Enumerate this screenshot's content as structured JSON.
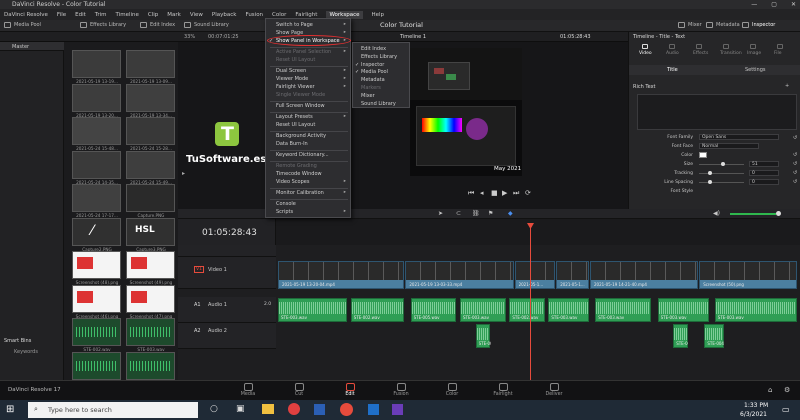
{
  "window": {
    "title": "DaVinci Resolve - Color Tutorial"
  },
  "menubar": [
    "DaVinci Resolve",
    "File",
    "Edit",
    "Trim",
    "Timeline",
    "Clip",
    "Mark",
    "View",
    "Playback",
    "Fusion",
    "Color",
    "Fairlight",
    "Workspace",
    "Help"
  ],
  "toolbar": {
    "media_pool": "Media Pool",
    "effects_library": "Effects Library",
    "edit_index": "Edit Index",
    "sound_library": "Sound Library",
    "project_title": "Color Tutorial",
    "mixer": "Mixer",
    "metadata": "Metadata",
    "inspector": "Inspector"
  },
  "subbar": {
    "zoom": "33%",
    "timecode_left": "00:07:01:25",
    "timeline_name": "Timeline 1",
    "timecode_right": "01:05:28:43"
  },
  "left_panel": {
    "master": "Master",
    "smart_bins": "Smart Bins",
    "keywords": "Keywords"
  },
  "media_pool": {
    "items": [
      "2021-05-19 13-19...",
      "2021-05-19 13-09...",
      "2021-05-19 13-20...",
      "2021-05-19 13-34...",
      "2021-05-24 15-48...",
      "2021-05-24 15-28...",
      "2021-05-24 14-35...",
      "2021-05-24 15-49...",
      "2021-05-24 17-17...",
      "Capture.PNG",
      "Capture2.PNG",
      "Capture3.PNG",
      "Screenshot (48).png",
      "Screenshot (49).png",
      "Screenshot (46).png",
      "Screenshot (47).png",
      "STE-002.wav",
      "STE-003.wav",
      "STE-004.wav",
      "STE-005.wav"
    ]
  },
  "workspace_menu": {
    "items": [
      {
        "label": "Switch to Page",
        "arrow": true
      },
      {
        "label": "Show Page",
        "arrow": true
      },
      {
        "label": "Show Panel in Workspace",
        "arrow": true,
        "highlight": true
      },
      {
        "label": "Active Panel Selection",
        "arrow": true,
        "dim": true
      },
      {
        "label": "Reset UI Layout",
        "dim": true
      },
      {
        "label": "Dual Screen",
        "arrow": true
      },
      {
        "label": "Viewer Mode",
        "arrow": true
      },
      {
        "label": "Fairlight Viewer",
        "arrow": true
      },
      {
        "label": "Single Viewer Mode",
        "dim": true
      },
      {
        "label": "Full Screen Window"
      },
      {
        "label": "Layout Presets",
        "arrow": true
      },
      {
        "label": "Reset UI Layout"
      },
      {
        "label": "Background Activity"
      },
      {
        "label": "Data Burn-In"
      },
      {
        "label": "Keyword Dictionary..."
      },
      {
        "label": "Remote Grading",
        "dim": true
      },
      {
        "label": "Timecode Window"
      },
      {
        "label": "Video Scopes",
        "arrow": true
      },
      {
        "label": "Monitor Calibration",
        "arrow": true
      },
      {
        "label": "Console"
      },
      {
        "label": "Scripts",
        "arrow": true
      }
    ],
    "submenu": [
      {
        "label": "Edit Index"
      },
      {
        "label": "Effects Library"
      },
      {
        "label": "Inspector",
        "check": true
      },
      {
        "label": "Media Pool",
        "check": true
      },
      {
        "label": "Metadata"
      },
      {
        "label": "Markers",
        "dim": true
      },
      {
        "label": "Mixer"
      },
      {
        "label": "Sound Library"
      }
    ]
  },
  "viewer": {
    "watermark": "TuSoftware.es",
    "logo_letter": "T",
    "overlay_date": "May 2021",
    "hsl_badge": "HSL"
  },
  "inspector": {
    "title": "Timeline - Title - Text",
    "tabs": [
      "Video",
      "Audio",
      "Effects",
      "Transition",
      "Image",
      "File"
    ],
    "subtabs": [
      "Title",
      "Settings"
    ],
    "section": "Rich Text",
    "font_family_label": "Font Family",
    "font_family": "Open Sans",
    "font_face_label": "Font Face",
    "font_face": "Normal",
    "color_label": "Color",
    "size_label": "Size",
    "size": "51",
    "tracking_label": "Tracking",
    "tracking": "0",
    "line_spacing_label": "Line Spacing",
    "line_spacing": "0",
    "font_style_label": "Font Style"
  },
  "timeline": {
    "timecode": "01:05:28:43",
    "video_track": {
      "id": "V1",
      "name": "Video 1"
    },
    "audio_tracks": [
      {
        "id": "A1",
        "name": "Audio 1",
        "level": "2.0"
      },
      {
        "id": "A2",
        "name": "Audio 2",
        "level": ""
      }
    ],
    "video_clips": [
      {
        "name": "2021-05-19 13-20-04.mp4",
        "start": 0,
        "end": 0.245
      },
      {
        "name": "2021-05-19 13-03-33.mp4",
        "start": 0.245,
        "end": 0.455
      },
      {
        "name": "2021-05-1...",
        "start": 0.455,
        "end": 0.535
      },
      {
        "name": "2021-05-1...",
        "start": 0.535,
        "end": 0.6
      },
      {
        "name": "2021-05-19 14-21-40.mp4",
        "start": 0.6,
        "end": 0.81
      },
      {
        "name": "Screenshot (50).png",
        "start": 0.81,
        "end": 1.0
      }
    ],
    "audio_clips_a1": [
      {
        "name": "STE-003.wav",
        "start": 0,
        "end": 0.135
      },
      {
        "name": "STE-002.wav",
        "start": 0.14,
        "end": 0.245
      },
      {
        "name": "STE-005.wav",
        "start": 0.255,
        "end": 0.345
      },
      {
        "name": "STE-003.wav",
        "start": 0.35,
        "end": 0.44
      },
      {
        "name": "STE-002.wav",
        "start": 0.445,
        "end": 0.515
      },
      {
        "name": "STE-003.wav",
        "start": 0.52,
        "end": 0.6
      },
      {
        "name": "STE-003.wav",
        "start": 0.61,
        "end": 0.72
      },
      {
        "name": "STE-003.wav",
        "start": 0.73,
        "end": 0.83
      },
      {
        "name": "STE-003.wav",
        "start": 0.84,
        "end": 1.0
      }
    ],
    "audio_clips_a2": [
      {
        "name": "STE-004.wav",
        "start": 0.38,
        "end": 0.41
      },
      {
        "name": "STE-004.wav",
        "start": 0.76,
        "end": 0.79
      },
      {
        "name": "STE-004.wav",
        "start": 0.82,
        "end": 0.86
      }
    ]
  },
  "pages": [
    "Media",
    "Cut",
    "Edit",
    "Fusion",
    "Color",
    "Fairlight",
    "Deliver"
  ],
  "active_page": "Edit",
  "app_version": "DaVinci Resolve 17",
  "taskbar": {
    "search_placeholder": "Type here to search",
    "time": "1:33 PM",
    "date": "6/3/2021"
  },
  "colors": {
    "accent_red": "#e64b3c",
    "video_clip": "#4b7fa0",
    "audio_clip": "#2f9e55",
    "playhead": "#e64b3c"
  }
}
